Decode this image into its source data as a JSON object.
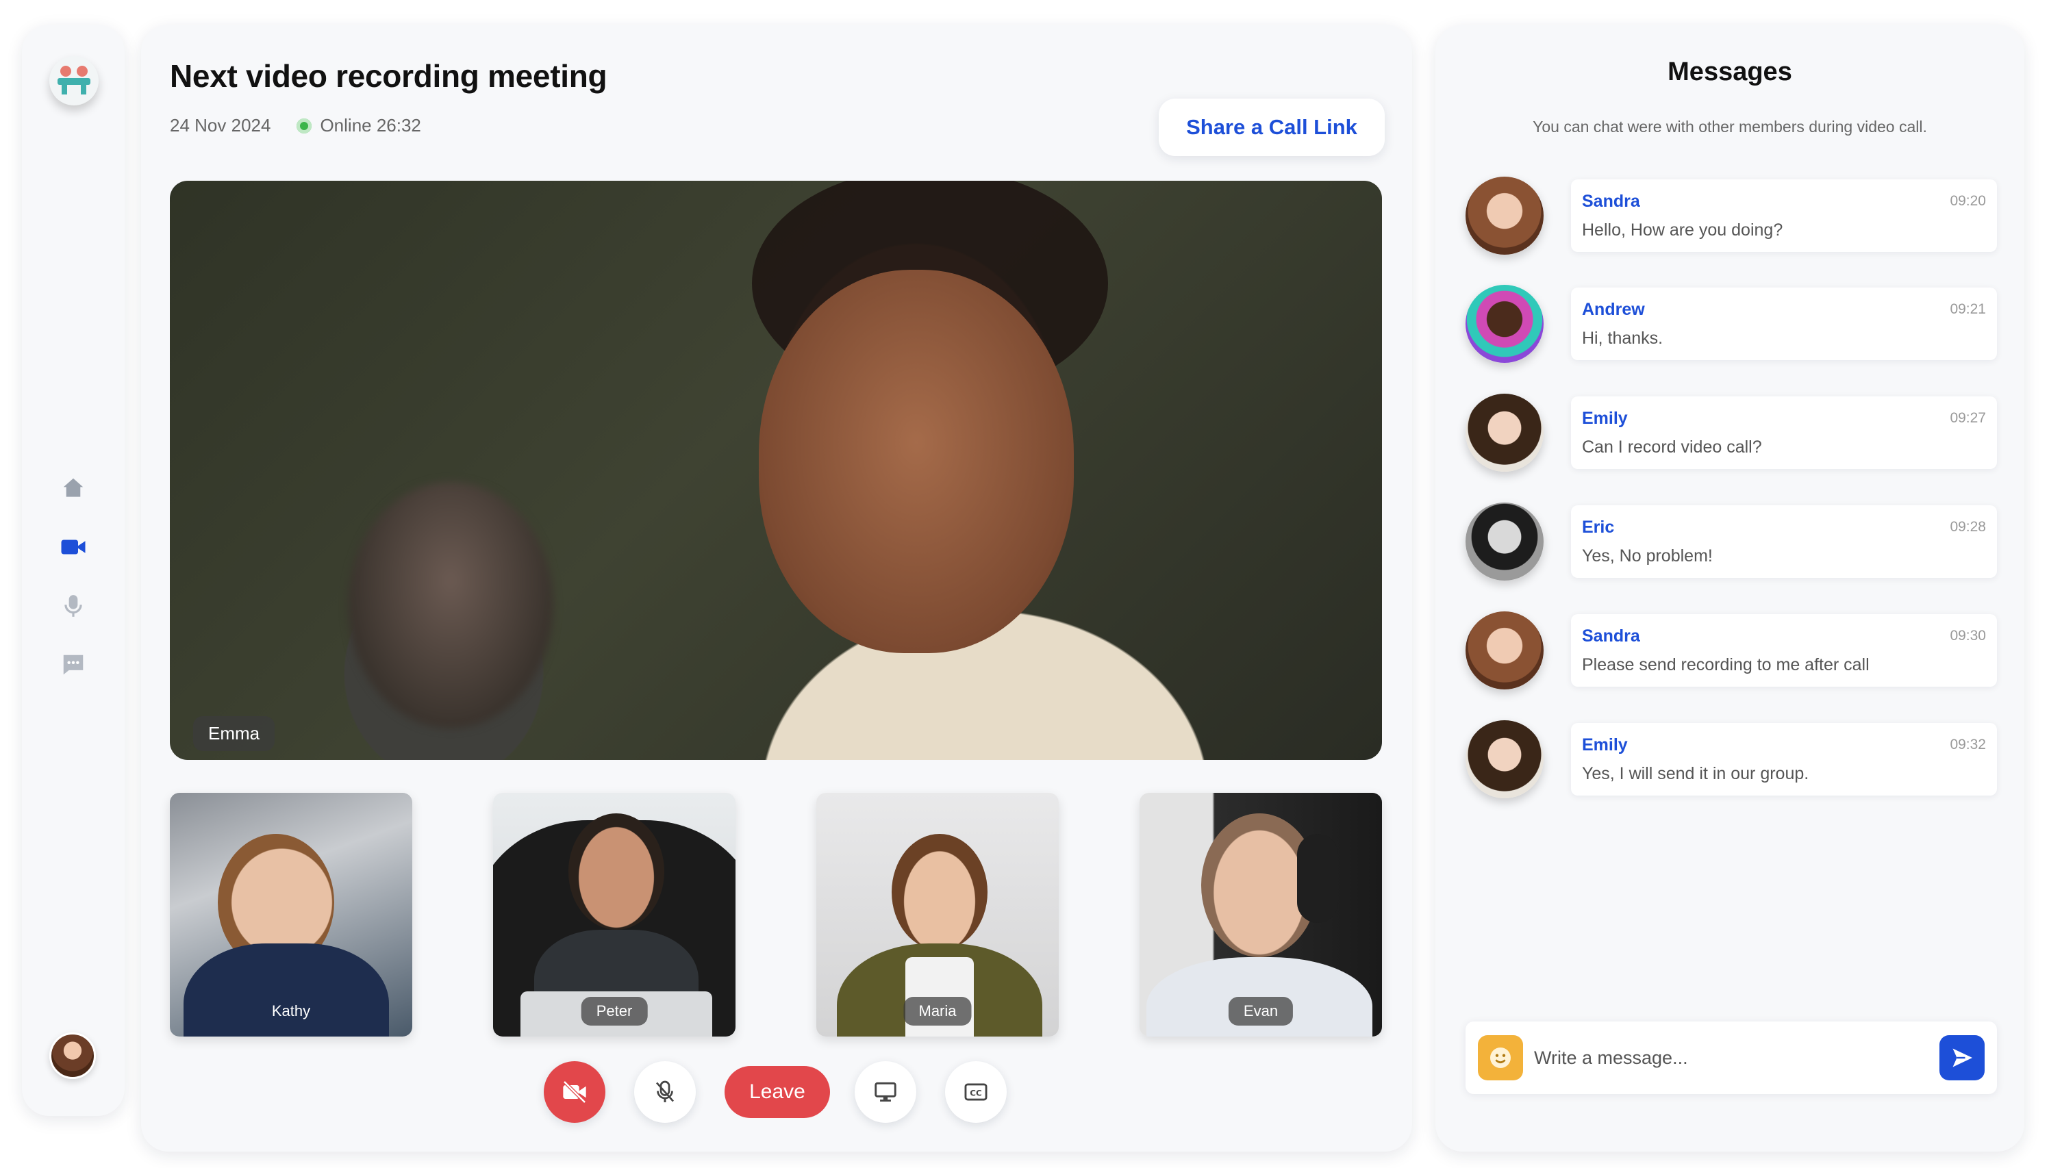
{
  "meeting": {
    "title": "Next video recording meeting",
    "date": "24 Nov 2024",
    "online": "Online 26:32",
    "share_label": "Share a Call Link"
  },
  "sidebar": {
    "items": [
      {
        "icon": "home-icon"
      },
      {
        "icon": "video-camera-icon",
        "active": true
      },
      {
        "icon": "microphone-icon"
      },
      {
        "icon": "chat-icon"
      }
    ]
  },
  "main_video": {
    "name": "Emma"
  },
  "participants": [
    {
      "name": "Kathy"
    },
    {
      "name": "Peter"
    },
    {
      "name": "Maria"
    },
    {
      "name": "Evan"
    }
  ],
  "controls": {
    "leave_label": "Leave",
    "buttons": [
      "camera-off-icon",
      "mic-off-icon",
      "screen-share-icon",
      "captions-icon"
    ]
  },
  "messages": {
    "title": "Messages",
    "subtitle": "You can chat were with other members during video call.",
    "items": [
      {
        "sender": "Sandra",
        "time": "09:20",
        "text": "Hello, How are you doing?"
      },
      {
        "sender": "Andrew",
        "time": "09:21",
        "text": "Hi, thanks."
      },
      {
        "sender": "Emily",
        "time": "09:27",
        "text": "Can I record video call?"
      },
      {
        "sender": "Eric",
        "time": "09:28",
        "text": "Yes, No problem!"
      },
      {
        "sender": "Sandra",
        "time": "09:30",
        "text": "Please send recording to me after call"
      },
      {
        "sender": "Emily",
        "time": "09:32",
        "text": "Yes, I will send it in our group."
      }
    ],
    "composer_placeholder": "Write a message..."
  },
  "colors": {
    "accent": "#1d4fd8",
    "danger": "#e2474b",
    "online": "#3ab54a",
    "background": "#f7f8fa"
  }
}
